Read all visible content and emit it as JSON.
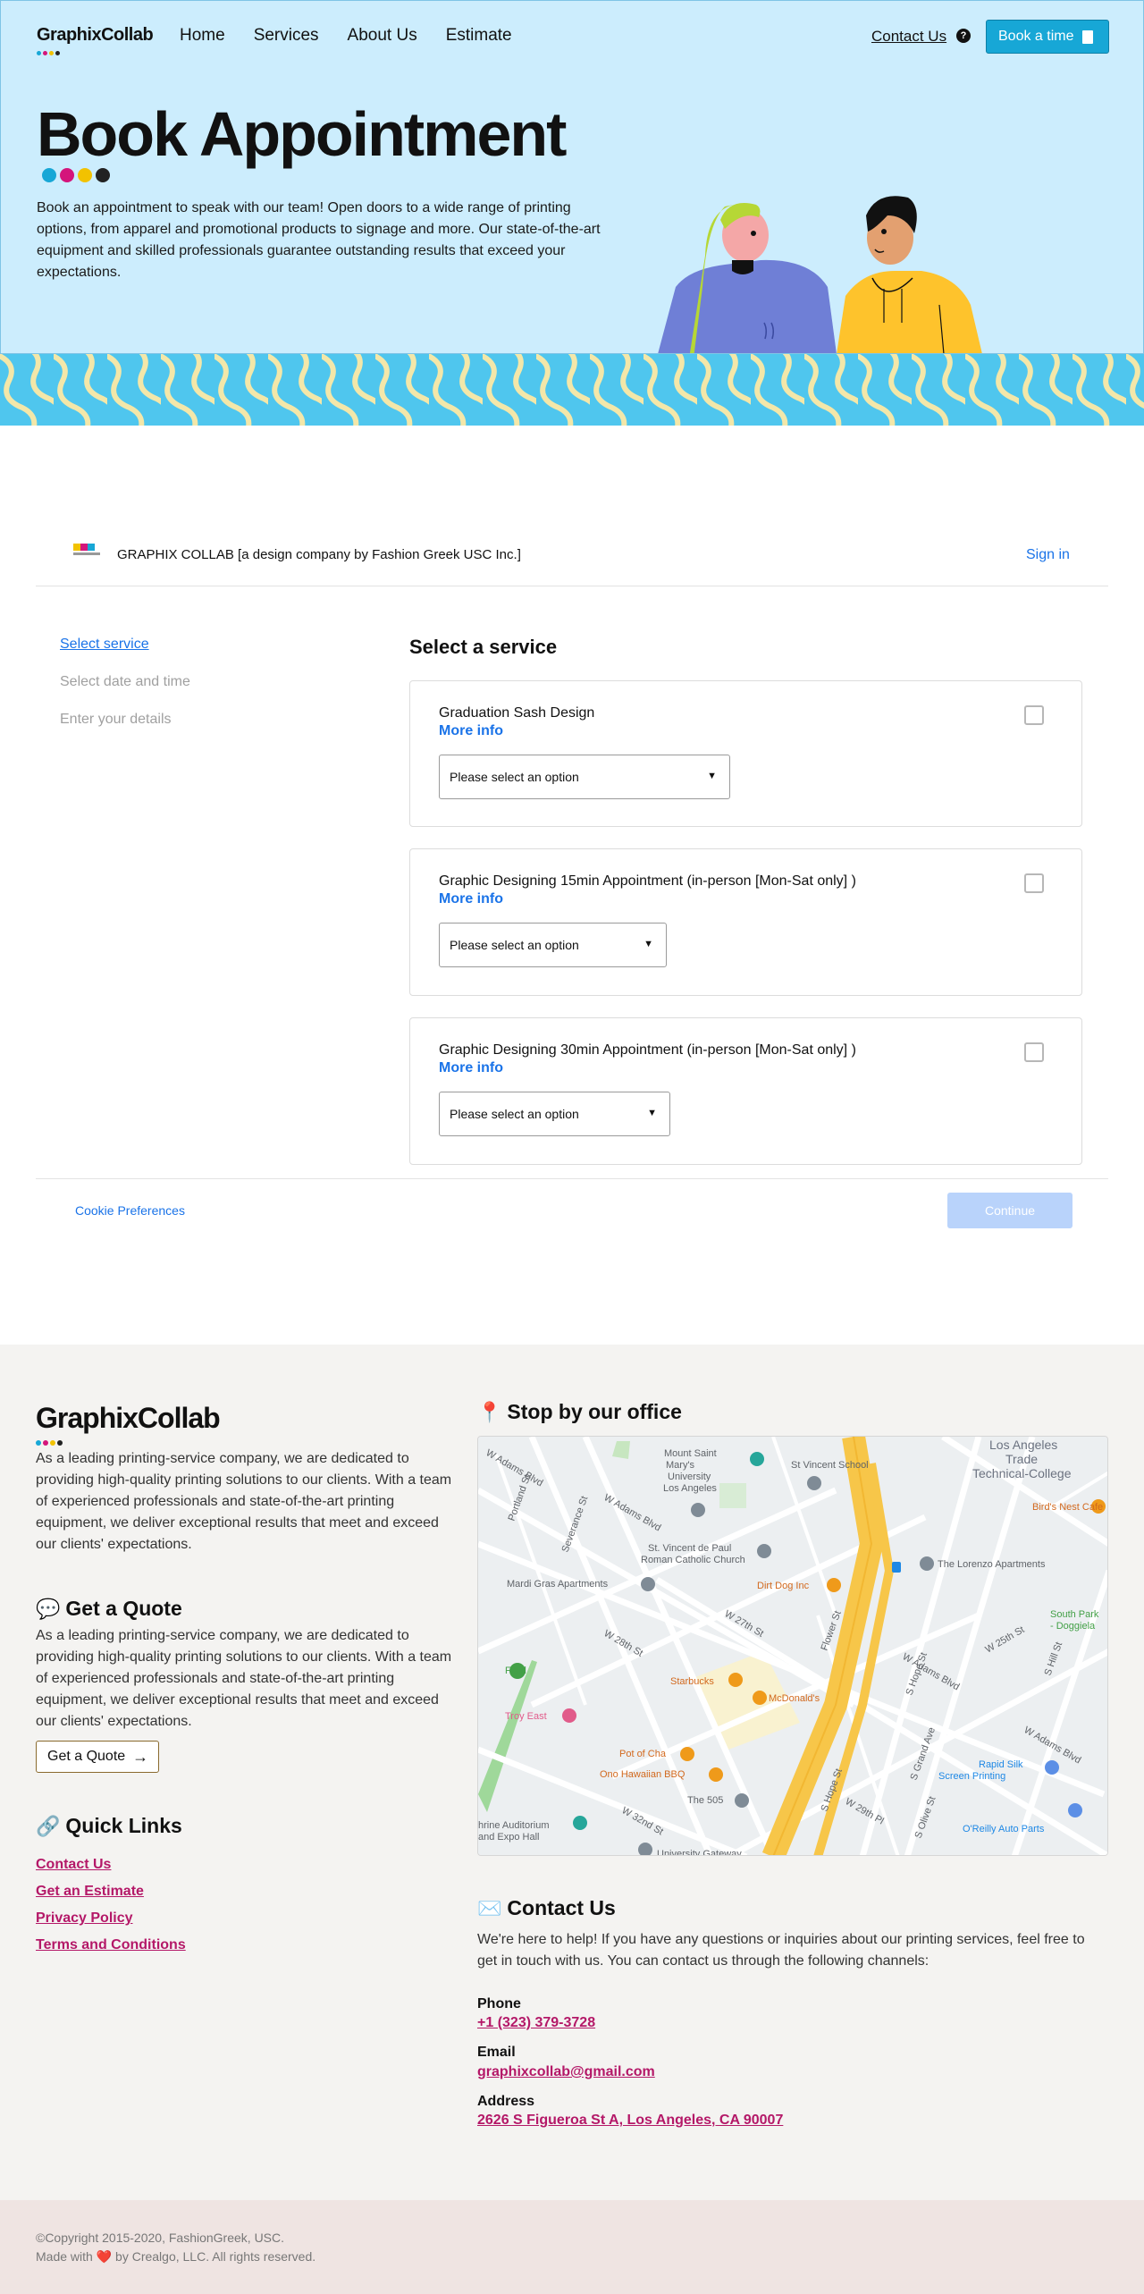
{
  "nav": {
    "logo": "GraphixCollab",
    "links": [
      "Home",
      "Services",
      "About Us",
      "Estimate"
    ],
    "contact": "Contact Us",
    "book_button": "Book a time"
  },
  "hero": {
    "title": "Book Appointment",
    "text": "Book an appointment to speak with our team! Open doors to a wide range of printing options, from apparel and promotional products to signage and more. Our state-of-the-art equipment and skilled professionals guarantee outstanding results that exceed your expectations."
  },
  "brand_colors": {
    "cyan": "#17a7d6",
    "magenta": "#d4157b",
    "yellow": "#f2c200",
    "black": "#222222",
    "link": "#1a73e8",
    "footer_link": "#b41868"
  },
  "booking": {
    "company": "GRAPHIX COLLAB [a design company by Fashion Greek USC Inc.]",
    "sign_in": "Sign in",
    "steps": [
      "Select service",
      "Select date and time",
      "Enter your details"
    ],
    "section_title": "Select a service",
    "services": [
      {
        "title": "Graduation Sash Design",
        "more_info": "More info",
        "select_placeholder": "Please select an option",
        "checked": false
      },
      {
        "title": "Graphic Designing 15min Appointment (in-person [Mon-Sat only] )",
        "more_info": "More info",
        "select_placeholder": "Please select an option",
        "checked": false
      },
      {
        "title": "Graphic Designing 30min Appointment (in-person [Mon-Sat only] )",
        "more_info": "More info",
        "select_placeholder": "Please select an option",
        "checked": false
      }
    ],
    "cookie_preferences": "Cookie Preferences",
    "continue": "Continue"
  },
  "footer": {
    "logo": "GraphixCollab",
    "about": "As a leading printing-service company, we are dedicated to providing high-quality printing solutions to our clients. With a team of experienced professionals and state-of-the-art printing equipment, we deliver exceptional results that meet and exceed our clients' expectations.",
    "quote_heading": "Get a Quote",
    "quote_text": "As a leading printing-service company, we are dedicated to providing high-quality printing solutions to our clients. With a team of experienced professionals and state-of-the-art printing equipment, we deliver exceptional results that meet and exceed our clients' expectations.",
    "quote_button": "Get a Quote",
    "quick_links_heading": "Quick Links",
    "quick_links": [
      "Contact Us",
      "Get an Estimate",
      "Privacy Policy",
      "Terms and Conditions"
    ],
    "office_heading": "Stop by our office",
    "map_labels": [
      "W Adams Blvd",
      "Mount Saint Mary's University Los Angeles",
      "St Vincent School",
      "Los Angeles Trade Technical-College",
      "Bird's Nest Cafe",
      "Portland St",
      "Severance St",
      "St. Vincent de Paul Roman Catholic Church",
      "Mardi Gras Apartments",
      "Dirt Dog Inc",
      "The Lorenzo Apartments",
      "South Park - Doggiela",
      "W 28th St",
      "W 27th St",
      "Flower St",
      "S Hope St",
      "W 25th St",
      "S Hill St",
      "Starbucks",
      "McDonald's",
      "Troy East",
      "Pot of Cha",
      "Ono Hawaiian BBQ",
      "The 505",
      "S Grand Ave",
      "Rapid Silk Screen Printing",
      "O'Reilly Auto Parts",
      "hrine Auditorium and Expo Hall",
      "University Gateway",
      "W 32nd St",
      "W 29th Pl",
      "S Olive St",
      "Field"
    ],
    "contact_heading": "Contact Us",
    "contact_text": "We're here to help! If you have any questions or inquiries about our printing services, feel free to get in touch with us. You can contact us through the following channels:",
    "phone_label": "Phone",
    "phone": "+1 (323) 379-3728",
    "email_label": "Email",
    "email": "graphixcollab@gmail.com",
    "address_label": "Address",
    "address": "2626 S Figueroa St A, Los Angeles, CA 90007",
    "copyright": "©Copyright 2015-2020, FashionGreek, USC.",
    "made_with_prefix": "Made with",
    "made_with_suffix": "by Crealgo, LLC. All rights reserved."
  }
}
